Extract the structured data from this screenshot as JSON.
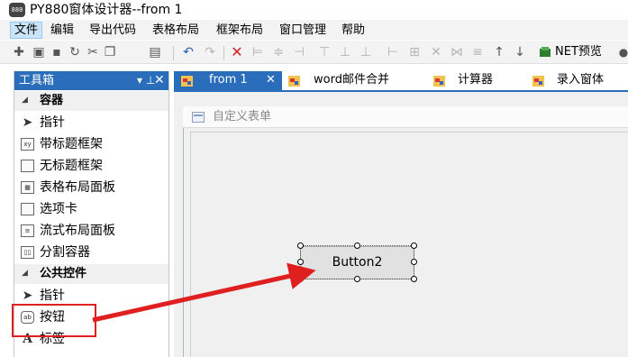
{
  "window": {
    "title": "PY880窗体设计器--from 1",
    "app_icon_text": "880"
  },
  "menubar": {
    "items": [
      "文件",
      "编辑",
      "导出代码",
      "表格布局",
      "框架布局",
      "窗口管理",
      "帮助"
    ],
    "active": "文件"
  },
  "toolbar": {
    "net_preview_label": "NET预览"
  },
  "toolbox": {
    "title": "工具箱",
    "pin_icon": "pin-icon",
    "close_icon": "close-icon",
    "groups": [
      {
        "label": "容器",
        "items": [
          "指针",
          "带标题框架",
          "无标题框架",
          "表格布局面板",
          "选项卡",
          "流式布局面板",
          "分割容器"
        ]
      },
      {
        "label": "公共控件",
        "items": [
          "指针",
          "按钮",
          "标签"
        ]
      }
    ],
    "highlighted_item": "按钮"
  },
  "tabs": [
    {
      "label": "from 1",
      "active": true,
      "closable": true
    },
    {
      "label": "word邮件合并",
      "active": false
    },
    {
      "label": "计算器",
      "active": false
    },
    {
      "label": "录入窗体",
      "active": false
    }
  ],
  "designer": {
    "form_title": "自定义表单",
    "button_label": "Button2"
  },
  "colors": {
    "accent": "#2a6ebb",
    "annotation": "#e02020"
  }
}
